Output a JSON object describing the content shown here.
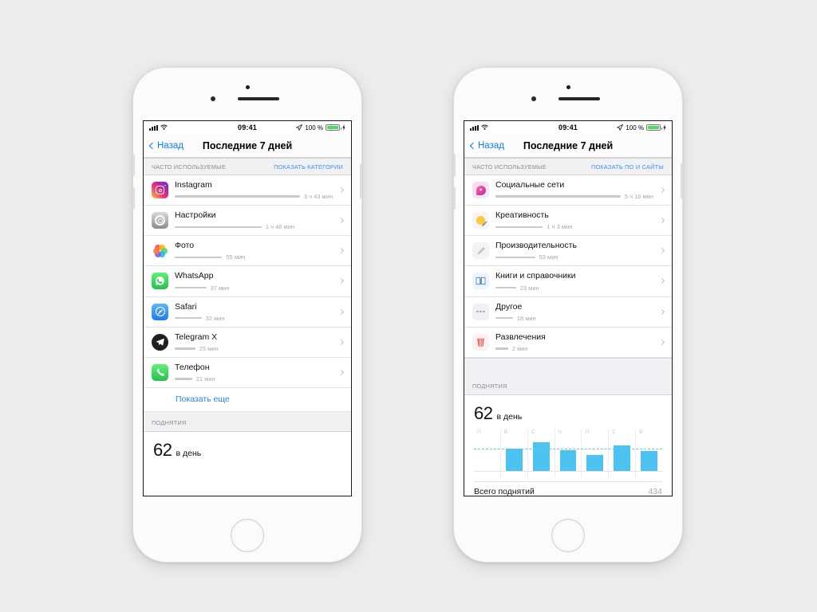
{
  "status_bar": {
    "signal_icon": "cellular-bars-icon",
    "wifi_icon": "wifi-icon",
    "time": "09:41",
    "location_icon": "location-arrow-icon",
    "battery_percent": "100 %",
    "charging_icon": "lightning-bolt-icon"
  },
  "nav": {
    "back_label": "Назад",
    "title": "Последние 7 дней"
  },
  "phone_left": {
    "section": {
      "label": "ЧАСТО ИСПОЛЬЗУЕМЫЕ",
      "link": "ПОКАЗАТЬ КАТЕГОРИИ"
    },
    "apps": [
      {
        "name": "Instagram",
        "duration": "3 ч 43 мин",
        "bar_width": "100%",
        "icon": "instagram-icon"
      },
      {
        "name": "Настройки",
        "duration": "1 ч 46 мин",
        "bar_width": "55%",
        "icon": "settings-icon"
      },
      {
        "name": "Фото",
        "duration": "55 мин",
        "bar_width": "30%",
        "icon": "photos-icon"
      },
      {
        "name": "WhatsApp",
        "duration": "37 мин",
        "bar_width": "20%",
        "icon": "whatsapp-icon"
      },
      {
        "name": "Safari",
        "duration": "32 мин",
        "bar_width": "17%",
        "icon": "safari-icon"
      },
      {
        "name": "Telegram X",
        "duration": "25 мин",
        "bar_width": "13%",
        "icon": "telegram-icon"
      },
      {
        "name": "Телефон",
        "duration": "21 мин",
        "bar_width": "11%",
        "icon": "phone-icon"
      }
    ],
    "show_more": "Показать еще",
    "pickups": {
      "header": "ПОДНЯТИЯ",
      "value": "62",
      "unit": "в день"
    }
  },
  "phone_right": {
    "section": {
      "label": "ЧАСТО ИСПОЛЬЗУЕМЫЕ",
      "link": "ПОКАЗАТЬ ПО И САЙТЫ"
    },
    "categories": [
      {
        "name": "Социальные сети",
        "duration": "5 ч 16 мин",
        "bar_width": "100%",
        "icon": "social-networks-icon"
      },
      {
        "name": "Креативность",
        "duration": "1 ч 3 мин",
        "bar_width": "30%",
        "icon": "creativity-icon"
      },
      {
        "name": "Производительность",
        "duration": "53 мин",
        "bar_width": "25%",
        "icon": "productivity-icon"
      },
      {
        "name": "Книги и справочники",
        "duration": "23 мин",
        "bar_width": "13%",
        "icon": "books-icon"
      },
      {
        "name": "Другое",
        "duration": "18 мин",
        "bar_width": "11%",
        "icon": "other-icon"
      },
      {
        "name": "Развлечения",
        "duration": "2 мин",
        "bar_width": "8%",
        "icon": "entertainment-icon"
      }
    ],
    "pickups": {
      "header": "ПОДНЯТИЯ",
      "value": "62",
      "unit": "в день",
      "total_label": "Всего поднятий",
      "total_value": "434"
    }
  },
  "chart_data": {
    "type": "bar",
    "title": "Поднятия",
    "categories": [
      "П",
      "В",
      "С",
      "Ч",
      "П",
      "С",
      "В"
    ],
    "values": [
      0,
      62,
      78,
      58,
      44,
      70,
      55
    ],
    "xlabel": "",
    "ylabel": "Поднятия",
    "ylim": [
      0,
      90
    ],
    "average_line": 62,
    "bar_color": "#4cc2f0",
    "average_line_color": "#5ec8f0",
    "grid": true,
    "legend": "none"
  },
  "colors": {
    "accent_blue": "#0a7cff",
    "link_blue": "#3c8dff",
    "chart_blue": "#4cc2f0",
    "page_bg": "#ececed",
    "section_bg": "#f1f1f3",
    "battery_green": "#4cd964"
  }
}
